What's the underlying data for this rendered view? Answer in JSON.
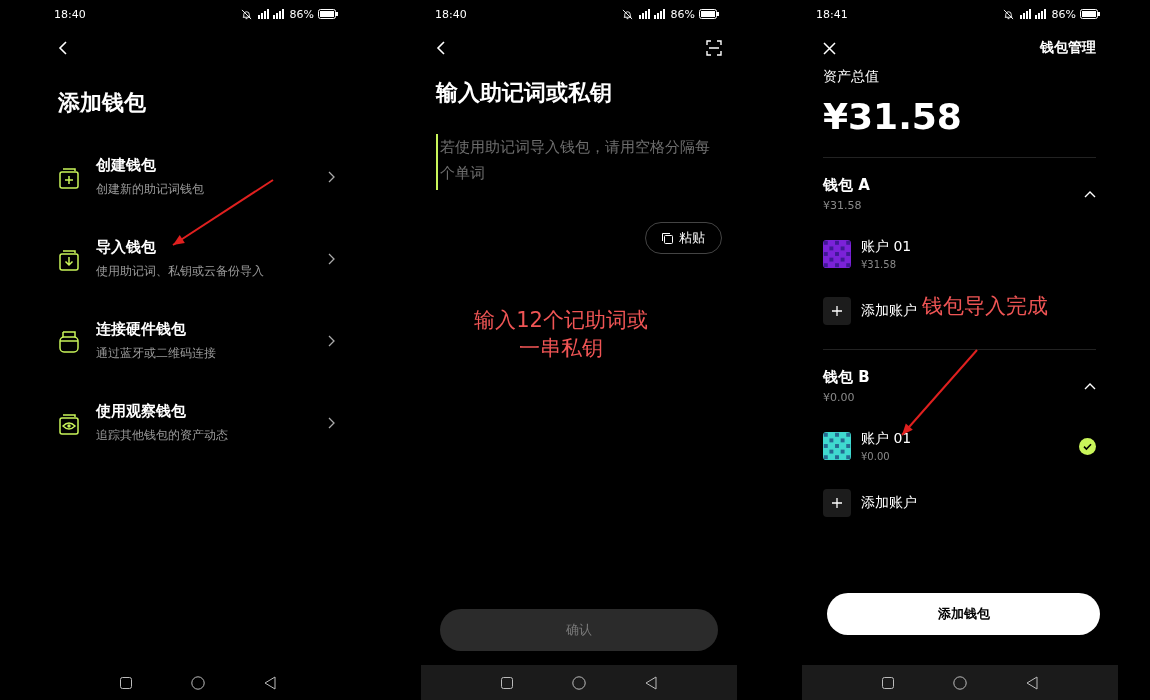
{
  "screens": [
    {
      "kind": "add",
      "status_bar": {
        "time": "18:40",
        "battery": "86%"
      },
      "title": "添加钱包",
      "options": [
        {
          "kind": "create",
          "title": "创建钱包",
          "subtitle": "创建新的助记词钱包"
        },
        {
          "kind": "import",
          "title": "导入钱包",
          "subtitle": "使用助记词、私钥或云备份导入"
        },
        {
          "kind": "hardware",
          "title": "连接硬件钱包",
          "subtitle": "通过蓝牙或二维码连接"
        },
        {
          "kind": "watch",
          "title": "使用观察钱包",
          "subtitle": "追踪其他钱包的资产动态"
        }
      ]
    },
    {
      "kind": "input",
      "status_bar": {
        "time": "18:40",
        "battery": "86%"
      },
      "title": "输入助记词或私钥",
      "input": {
        "placeholder": "若使用助记词导入钱包，请用空格分隔每个单词"
      },
      "paste_button": "粘贴",
      "annotation": {
        "lines": [
          "输入12个记助词或",
          "一串私钥"
        ]
      },
      "confirm_button": {
        "label": "确认",
        "disabled": true
      }
    },
    {
      "kind": "manage",
      "status_bar": {
        "time": "18:41",
        "battery": "86%"
      },
      "header_action": "钱包管理",
      "total_label": "资产总值",
      "total": "¥31.58",
      "wallets": [
        {
          "name": "钱包 A",
          "balance": "¥31.58",
          "expanded": true,
          "accounts": [
            {
              "name": "账户 01",
              "balance": "¥31.58",
              "color": "#7b22d8",
              "selected": false
            }
          ],
          "add_account": "添加账户"
        },
        {
          "name": "钱包 B",
          "balance": "¥0.00",
          "expanded": true,
          "accounts": [
            {
              "name": "账户 01",
              "balance": "¥0.00",
              "color": "#3fd9cf",
              "selected": true
            }
          ],
          "add_account": "添加账户"
        }
      ],
      "annotation": {
        "lines": [
          "钱包导入完成"
        ]
      },
      "add_wallet_button": "添加钱包"
    }
  ]
}
